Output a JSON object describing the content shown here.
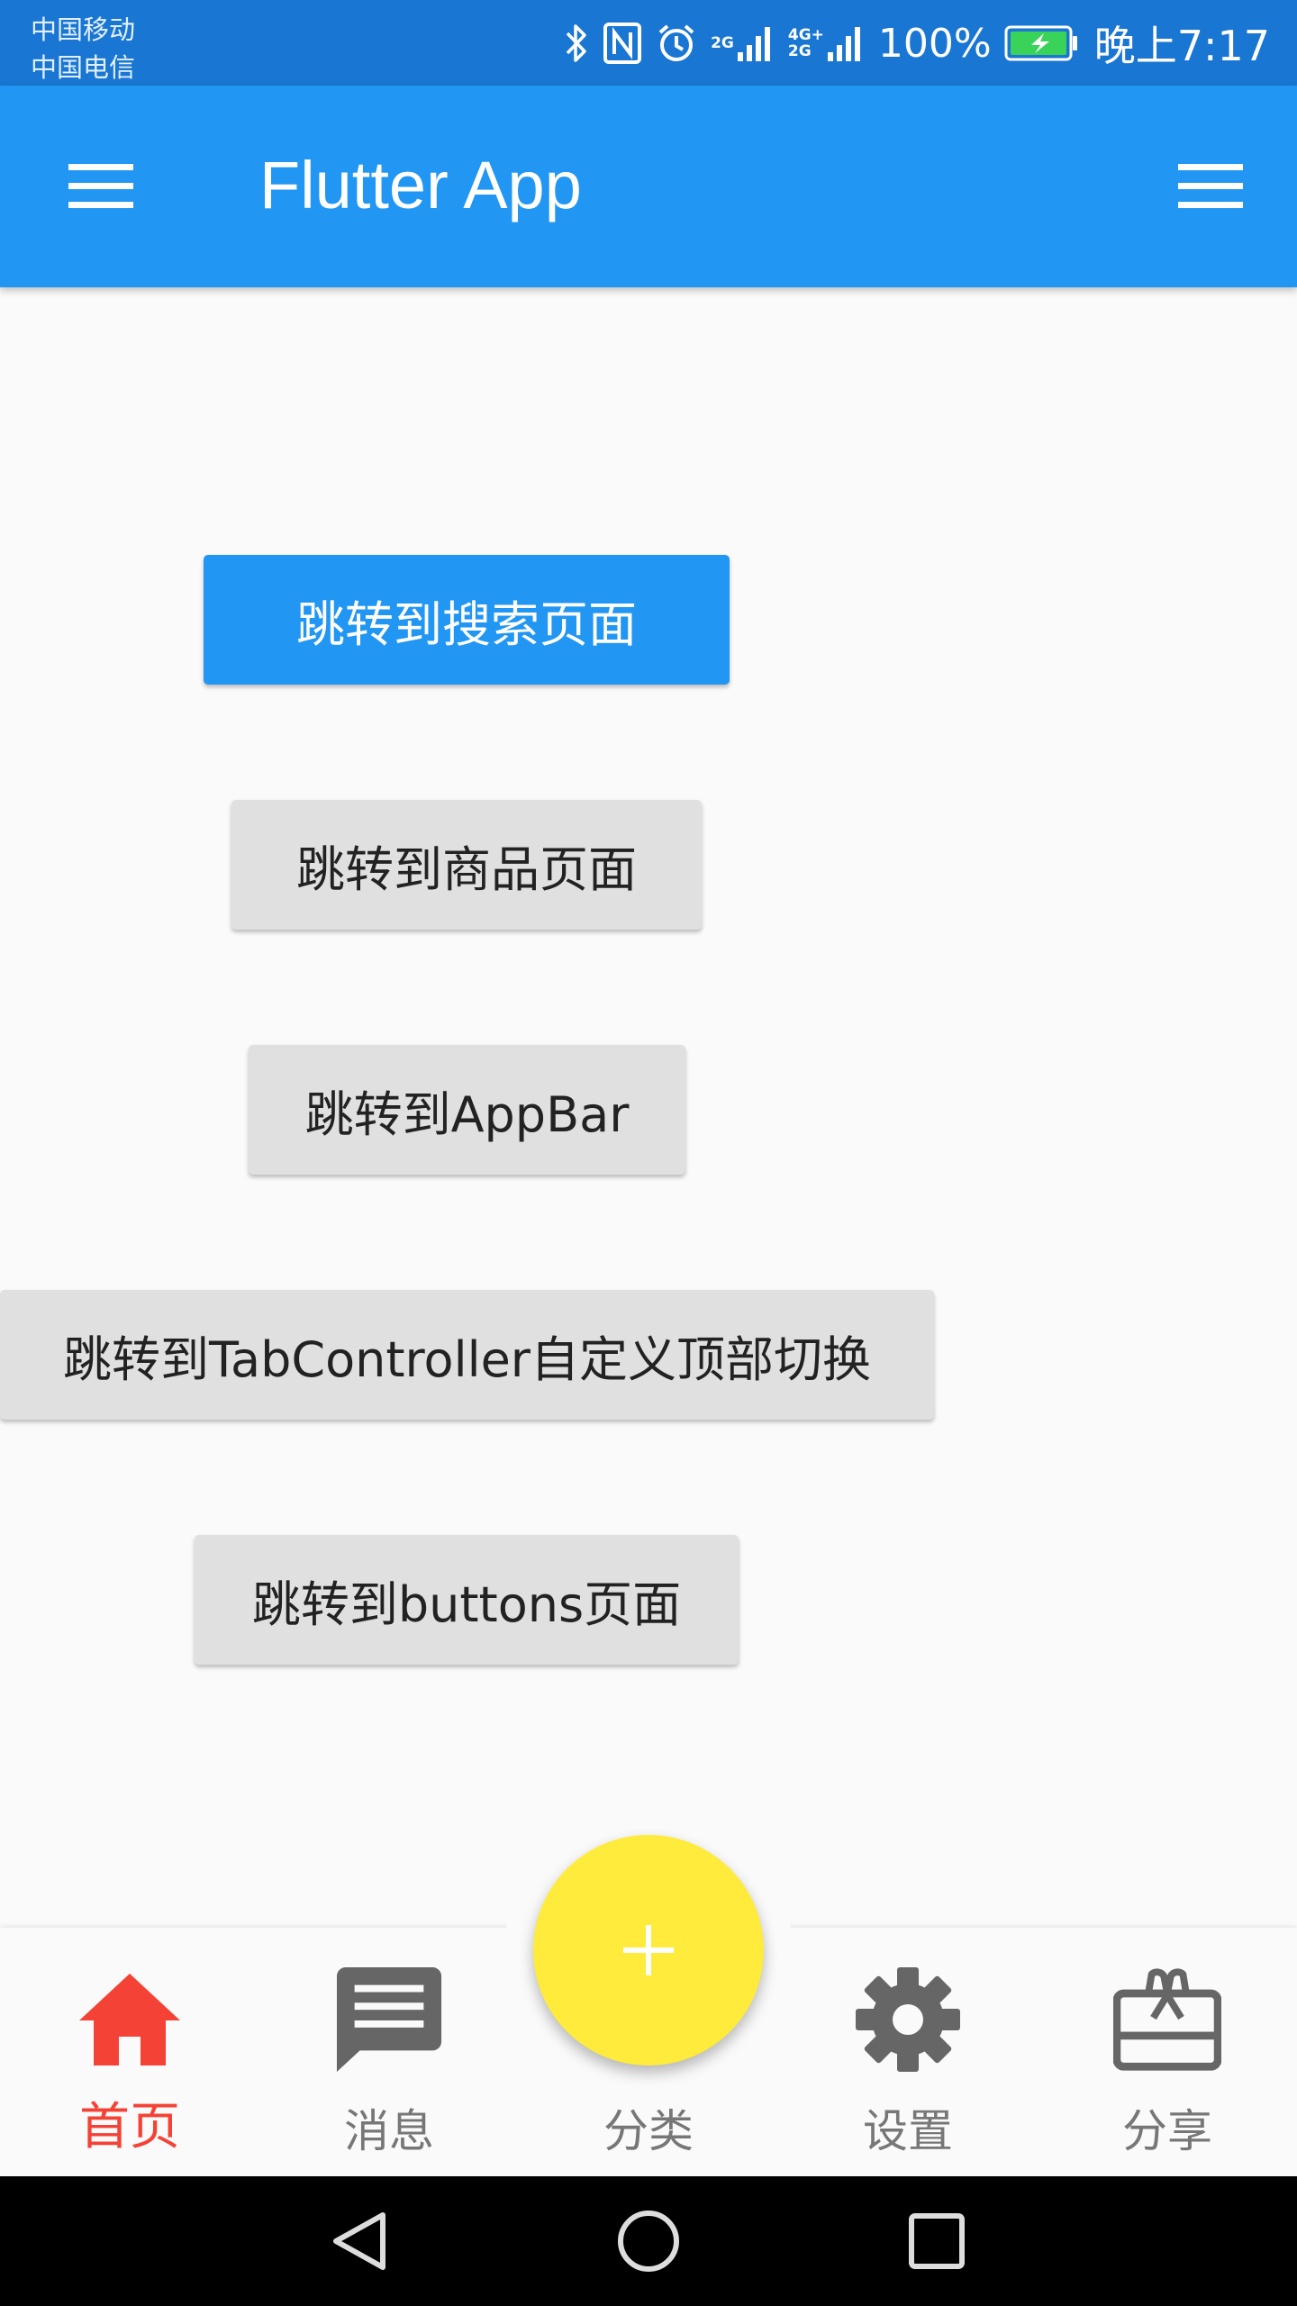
{
  "status_bar": {
    "carrier_1": "中国移动",
    "carrier_2": "中国电信",
    "network_1": "2G",
    "network_2_top": "4G+",
    "network_2_bottom": "2G",
    "battery_percent": "100%",
    "time": "晚上7:17",
    "icons": [
      "bluetooth-icon",
      "nfc-icon",
      "alarm-icon",
      "signal-icon",
      "signal-icon",
      "battery-charging-icon"
    ]
  },
  "app_bar": {
    "title": "Flutter App",
    "left_icon": "menu-icon",
    "right_icon": "menu-icon"
  },
  "buttons": {
    "search": "跳转到搜索页面",
    "product": "跳转到商品页面",
    "appbar": "跳转到AppBar",
    "tabcontroller": "跳转到TabController自定义顶部切换",
    "buttons": "跳转到buttons页面"
  },
  "bottom_nav": {
    "items": [
      {
        "label": "首页",
        "icon": "home-icon",
        "active": true
      },
      {
        "label": "消息",
        "icon": "message-icon",
        "active": false
      },
      {
        "label": "分类",
        "icon": "add-icon",
        "active": false
      },
      {
        "label": "设置",
        "icon": "settings-icon",
        "active": false
      },
      {
        "label": "分享",
        "icon": "card-giftcard-icon",
        "active": false
      }
    ]
  },
  "colors": {
    "status_bar": "#1976d2",
    "app_bar": "#2196f3",
    "primary_button": "#2196f3",
    "secondary_button": "#e0e0e0",
    "active_nav": "#f44336",
    "inactive_nav": "#666666",
    "fab": "#ffeb3b"
  },
  "system_nav": {
    "icons": [
      "back-icon",
      "home-circle-icon",
      "recents-icon"
    ]
  }
}
